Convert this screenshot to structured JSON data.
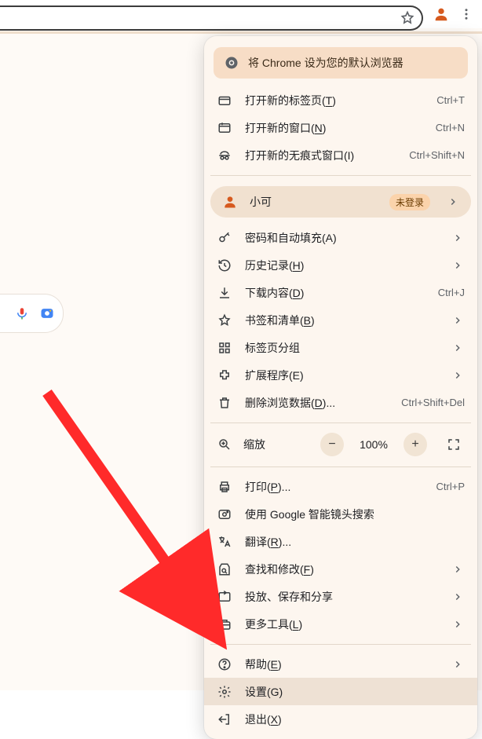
{
  "toolbar": {
    "profile_color": "#d65a1f",
    "menu_color": "#5f6368"
  },
  "banner": {
    "text": "将 Chrome 设为您的默认浏览器"
  },
  "profile": {
    "name": "小可",
    "badge": "未登录"
  },
  "zoom": {
    "label": "缩放",
    "minus": "−",
    "pct": "100%",
    "plus": "+"
  },
  "items": {
    "new_tab": {
      "label": "打开新的标签页",
      "u": "T",
      "suffix": ")",
      "sc": "Ctrl+T"
    },
    "new_window": {
      "label": "打开新的窗口(",
      "u": "N",
      "suffix": ")",
      "sc": "Ctrl+N"
    },
    "incognito": {
      "label": "打开新的无痕式窗口(I)",
      "sc": "Ctrl+Shift+N"
    },
    "passwords": {
      "label": "密码和自动填充(A)"
    },
    "history": {
      "label": "历史记录(",
      "u": "H",
      "suffix": ")"
    },
    "downloads": {
      "label": "下载内容(",
      "u": "D",
      "suffix": ")",
      "sc": "Ctrl+J"
    },
    "bookmarks": {
      "label": "书签和清单(",
      "u": "B",
      "suffix": ")"
    },
    "tabgroups": {
      "label": "标签页分组"
    },
    "extensions": {
      "label": "扩展程序(E)"
    },
    "clear_data": {
      "label": "删除浏览数据(",
      "u": "D",
      "suffix": ")...",
      "sc": "Ctrl+Shift+Del"
    },
    "print": {
      "label": "打印(",
      "u": "P",
      "suffix": ")...",
      "sc": "Ctrl+P"
    },
    "lens": {
      "label": "使用 Google 智能镜头搜索"
    },
    "translate": {
      "label": "翻译(",
      "u": "R",
      "suffix": ")..."
    },
    "find": {
      "label": "查找和修改(",
      "u": "F",
      "suffix": ")"
    },
    "cast": {
      "label": "投放、保存和分享"
    },
    "more_tools": {
      "label": "更多工具(",
      "u": "L",
      "suffix": ")"
    },
    "help": {
      "label": "帮助(",
      "u": "E",
      "suffix": ")"
    },
    "settings": {
      "label": "设置(G)"
    },
    "exit": {
      "label": "退出(",
      "u": "X",
      "suffix": ")"
    }
  }
}
